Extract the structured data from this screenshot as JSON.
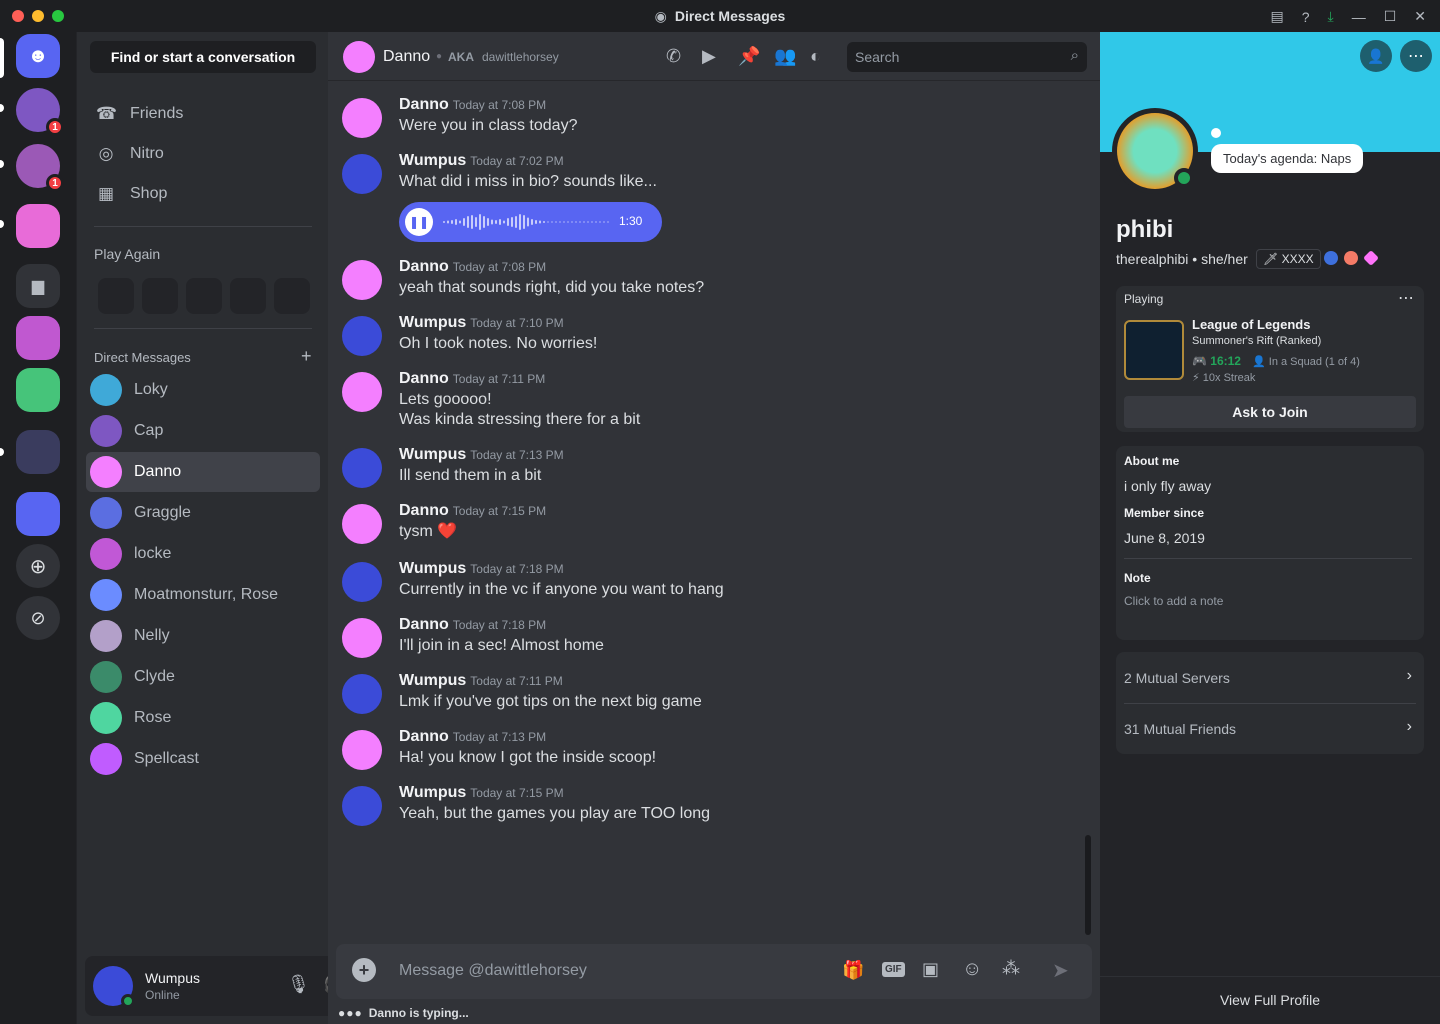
{
  "window": {
    "title": "Direct Messages"
  },
  "dm_sidebar": {
    "find_button": "Find or start a conversation",
    "nav": [
      {
        "label": "Friends"
      },
      {
        "label": "Nitro"
      },
      {
        "label": "Shop"
      }
    ],
    "play_again_label": "Play Again",
    "direct_messages_label": "Direct Messages",
    "add_icon": "plus-icon",
    "dms": [
      {
        "name": "Loky",
        "color": "#3fa9d8"
      },
      {
        "name": "Cap",
        "color": "#7e57c2"
      },
      {
        "name": "Danno",
        "color": "#f47fff"
      },
      {
        "name": "Graggle",
        "color": "#5b6ee1"
      },
      {
        "name": "locke",
        "color": "#c158d6"
      },
      {
        "name": "Moatmonsturr, Rose",
        "color": "#6b8cff"
      },
      {
        "name": "Nelly",
        "color": "#b3a0c9"
      },
      {
        "name": "Clyde",
        "color": "#3b8b6a"
      },
      {
        "name": "Rose",
        "color": "#4fd6a0"
      },
      {
        "name": "Spellcast",
        "color": "#c05cff"
      }
    ]
  },
  "user_panel": {
    "name": "Wumpus",
    "status": "Online"
  },
  "server_badges": [
    "1",
    "1"
  ],
  "chat_header": {
    "name": "Danno",
    "aka_label": "AKA",
    "aka_value": "dawittlehorsey",
    "search_placeholder": "Search"
  },
  "messages": [
    {
      "author": "Danno",
      "time": "Today at 7:08 PM",
      "lines": [
        "Were you in class today?"
      ]
    },
    {
      "author": "Wumpus",
      "time": "Today at 7:02 PM",
      "lines": [
        "What did i miss in bio? sounds like..."
      ]
    },
    {
      "author": "Danno",
      "time": "Today at 7:08 PM",
      "lines": [
        "yeah that sounds right, did you take notes?"
      ]
    },
    {
      "author": "Wumpus",
      "time": "Today at 7:10 PM",
      "lines": [
        "Oh I took notes. No worries!"
      ]
    },
    {
      "author": "Danno",
      "time": "Today at 7:11 PM",
      "lines": [
        "Lets gooooo!",
        "Was kinda stressing there for a bit"
      ]
    },
    {
      "author": "Wumpus",
      "time": "Today at 7:13 PM",
      "lines": [
        "Ill send them in a bit"
      ]
    },
    {
      "author": "Danno",
      "time": "Today at 7:15 PM",
      "lines": [
        "tysm ❤️"
      ]
    },
    {
      "author": "Wumpus",
      "time": "Today at 7:18 PM",
      "lines": [
        "Currently in the vc if anyone you want to hang"
      ]
    },
    {
      "author": "Danno",
      "time": "Today at 7:18 PM",
      "lines": [
        "I'll join in a sec! Almost home"
      ]
    },
    {
      "author": "Wumpus",
      "time": "Today at 7:11 PM",
      "lines": [
        "Lmk if you've got tips on the next big game"
      ]
    },
    {
      "author": "Danno",
      "time": "Today at 7:13 PM",
      "lines": [
        "Ha! you know I got the inside scoop!"
      ]
    },
    {
      "author": "Wumpus",
      "time": "Today at 7:15 PM",
      "lines": [
        "Yeah, but the games you play are TOO long"
      ]
    }
  ],
  "voice_message": {
    "duration": "1:30"
  },
  "composer": {
    "placeholder": "Message @dawittlehorsey",
    "typing": "Danno is typing..."
  },
  "profile": {
    "status_bubble": "Today's agenda: Naps",
    "display_name": "phibi",
    "username_line": "therealphibi • she/her",
    "tag": "XXXX",
    "playing_label": "Playing",
    "game_title": "League of Legends",
    "game_mode": "Summoner's Rift (Ranked)",
    "game_time": "16:12",
    "squad": "In a Squad (1 of 4)",
    "streak": "10x Streak",
    "ask_button": "Ask to Join",
    "about_label": "About me",
    "about_text": "i only fly away",
    "member_since_label": "Member since",
    "member_since": "June 8, 2019",
    "note_label": "Note",
    "note_placeholder": "Click to add a note",
    "mutual_servers": "2 Mutual Servers",
    "mutual_friends": "31 Mutual Friends",
    "view_full": "View Full Profile"
  },
  "colors": {
    "blurple": "#5865f2",
    "online": "#23a55a",
    "banner": "#30c8e8"
  }
}
